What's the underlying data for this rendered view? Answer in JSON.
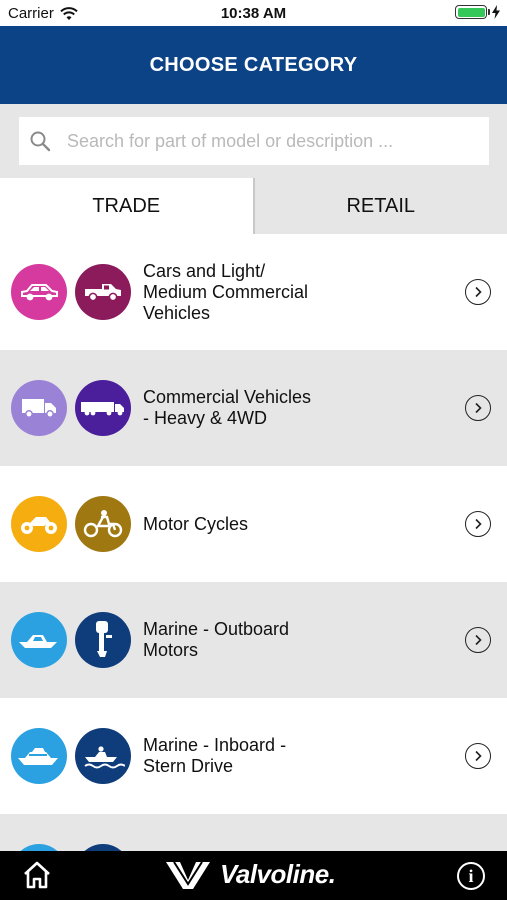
{
  "status_bar": {
    "carrier": "Carrier",
    "time": "10:38 AM",
    "battery_level": 1.0
  },
  "header": {
    "title": "CHOOSE CATEGORY"
  },
  "search": {
    "placeholder": "Search for part of model or description ..."
  },
  "tabs": [
    {
      "label": "TRADE",
      "active": true
    },
    {
      "label": "RETAIL",
      "active": false
    }
  ],
  "categories": [
    {
      "label": "Cars and Light/\nMedium Commercial\nVehicles",
      "icons": [
        "car-icon",
        "ute-icon"
      ],
      "colors": [
        "#d63a9e",
        "#8c1b5c"
      ]
    },
    {
      "label": "Commercial Vehicles\n- Heavy & 4WD",
      "icons": [
        "truck-icon",
        "semi-trailer-icon"
      ],
      "colors": [
        "#9a82d6",
        "#4b1f9c"
      ]
    },
    {
      "label": "Motor Cycles",
      "icons": [
        "motorcycle-icon",
        "dirt-bike-icon"
      ],
      "colors": [
        "#f5ad10",
        "#a07812"
      ]
    },
    {
      "label": "Marine - Outboard\nMotors",
      "icons": [
        "speedboat-icon",
        "outboard-motor-icon"
      ],
      "colors": [
        "#2ba1e2",
        "#0f3c7a"
      ]
    },
    {
      "label": "Marine - Inboard -\nStern Drive",
      "icons": [
        "yacht-icon",
        "jetboat-icon"
      ],
      "colors": [
        "#2ba1e2",
        "#0f3c7a"
      ]
    }
  ],
  "bottom_bar": {
    "brand": "Valvoline."
  }
}
